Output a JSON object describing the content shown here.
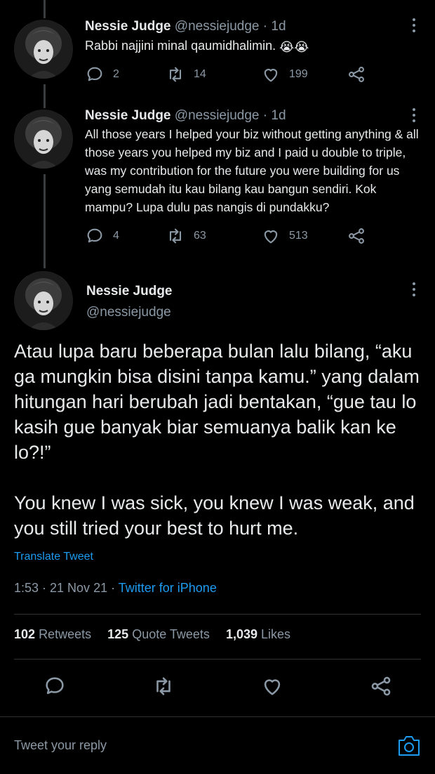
{
  "tweets": [
    {
      "name": "Nessie Judge",
      "handle": "@nessiejudge",
      "age": "· 1d",
      "text": "Rabbi najjini minal qaumidhalimin.",
      "emoji": "😭😭",
      "replies": "2",
      "retweets": "14",
      "likes": "199"
    },
    {
      "name": "Nessie Judge",
      "handle": "@nessiejudge",
      "age": "· 1d",
      "text": "All those years I helped your biz without getting anything & all those years you helped my biz and I paid u double to triple, was my contribution for the future you were building for us yang semudah itu kau bilang kau bangun sendiri. Kok mampu? Lupa dulu pas nangis di pundakku?",
      "replies": "4",
      "retweets": "63",
      "likes": "513"
    }
  ],
  "main": {
    "name": "Nessie Judge",
    "handle": "@nessiejudge",
    "paragraph1": "Atau lupa baru beberapa bulan lalu bilang, “aku ga mungkin bisa disini tanpa kamu.” yang dalam hitungan hari berubah jadi bentakan, “gue tau lo kasih gue banyak biar semuanya balik kan ke lo?!”",
    "paragraph2": "You knew I was sick, you knew I was weak, and you still tried your best to hurt me.",
    "translate": "Translate Tweet",
    "time": "1:53 · 21 Nov 21 · ",
    "source": "Twitter for iPhone",
    "retweets_count": "102",
    "retweets_label": "Retweets",
    "quotes_count": "125",
    "quotes_label": "Quote Tweets",
    "likes_count": "1,039",
    "likes_label": "Likes"
  },
  "reply_placeholder": "Tweet your reply",
  "icons": {
    "reply": "reply-icon",
    "retweet": "retweet-icon",
    "like": "heart-icon",
    "share": "share-icon",
    "more": "more-vertical-icon",
    "camera": "camera-icon"
  },
  "colors": {
    "background": "#000000",
    "text": "#e7e9ea",
    "muted": "#8b98a5",
    "accent": "#1d9bf0"
  }
}
